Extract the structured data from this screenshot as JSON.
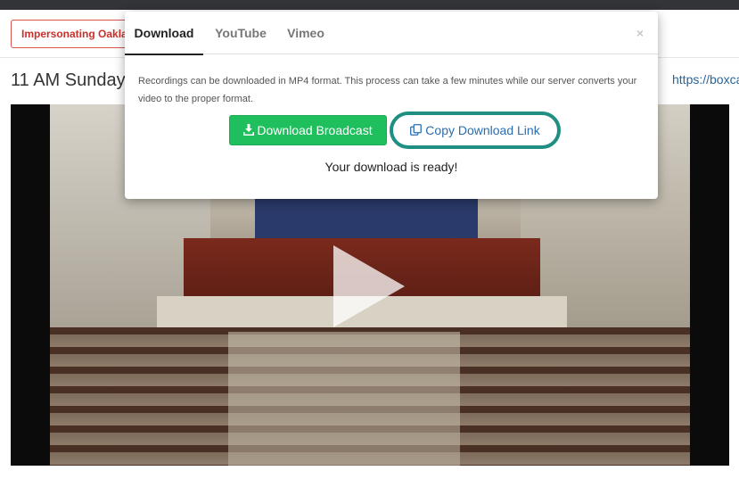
{
  "page": {
    "impersonating_label": "Impersonating Oakland",
    "event_title": "11 AM Sunday",
    "link_text": "https://boxcast"
  },
  "video": {
    "play_icon": "play-icon"
  },
  "modal": {
    "tabs": [
      {
        "label": "Download",
        "active": true
      },
      {
        "label": "YouTube",
        "active": false
      },
      {
        "label": "Vimeo",
        "active": false
      }
    ],
    "close_label": "×",
    "description": "Recordings can be downloaded in MP4 format. This process can take a few minutes while our server converts your video to the proper format.",
    "download_button_label": "Download Broadcast",
    "copy_button_label": "Copy Download Link",
    "status_text": "Your download is ready!",
    "colors": {
      "download_button": "#1fbf5d",
      "copy_ring": "#1e8f82",
      "copy_text": "#2a6db0"
    }
  }
}
